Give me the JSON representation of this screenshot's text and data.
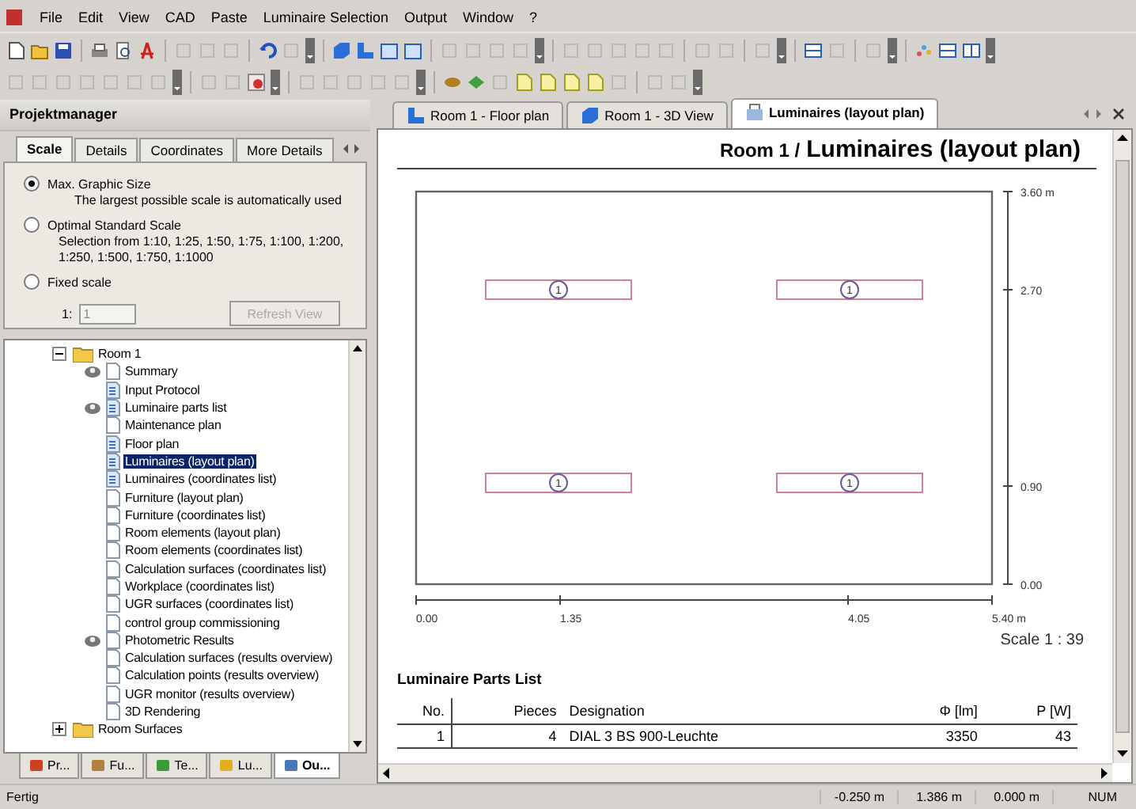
{
  "menu": [
    "File",
    "Edit",
    "View",
    "CAD",
    "Paste",
    "Luminaire Selection",
    "Output",
    "Window",
    "?"
  ],
  "project_manager": {
    "title": "Projektmanager",
    "tabs": [
      {
        "label": "Scale",
        "selected": true
      },
      {
        "label": "Details",
        "selected": false
      },
      {
        "label": "Coordinates",
        "selected": false
      },
      {
        "label": "More Details",
        "selected": false
      }
    ],
    "scale_options": [
      {
        "label": "Max. Graphic Size",
        "description": "The largest possible scale is automatically used",
        "selected": true
      },
      {
        "label": "Optimal Standard Scale",
        "description": "Selection from 1:10, 1:25, 1:50, 1:75, 1:100, 1:200, 1:250, 1:500, 1:750, 1:1000",
        "selected": false
      },
      {
        "label": "Fixed scale",
        "selected": false
      }
    ],
    "fixed_scale": {
      "prefix": "1:",
      "value": "1",
      "disabled": true
    },
    "refresh_button": {
      "label": "Refresh View",
      "disabled": true
    },
    "tree": [
      {
        "label": "Room 1",
        "kind": "folder",
        "expanded": true,
        "children": [
          {
            "label": "Summary",
            "kind": "page",
            "settings": true,
            "selected": false
          },
          {
            "label": "Input Protocol",
            "kind": "report",
            "settings": false,
            "selected": false
          },
          {
            "label": "Luminaire parts list",
            "kind": "report",
            "settings": true,
            "selected": false
          },
          {
            "label": "Maintenance plan",
            "kind": "page",
            "settings": false,
            "selected": false
          },
          {
            "label": "Floor plan",
            "kind": "report",
            "settings": false,
            "selected": false
          },
          {
            "label": "Luminaires (layout plan)",
            "kind": "report",
            "settings": false,
            "selected": true
          },
          {
            "label": "Luminaires (coordinates list)",
            "kind": "report",
            "settings": false,
            "selected": false
          },
          {
            "label": "Furniture (layout plan)",
            "kind": "page",
            "settings": false,
            "selected": false
          },
          {
            "label": "Furniture (coordinates list)",
            "kind": "page",
            "settings": false,
            "selected": false
          },
          {
            "label": "Room elements (layout plan)",
            "kind": "page",
            "settings": false,
            "selected": false
          },
          {
            "label": "Room elements (coordinates list)",
            "kind": "page",
            "settings": false,
            "selected": false
          },
          {
            "label": "Calculation surfaces (coordinates list)",
            "kind": "page",
            "settings": false,
            "selected": false
          },
          {
            "label": "Workplace (coordinates list)",
            "kind": "page",
            "settings": false,
            "selected": false
          },
          {
            "label": "UGR surfaces (coordinates list)",
            "kind": "page",
            "settings": false,
            "selected": false
          },
          {
            "label": "control group commissioning",
            "kind": "page",
            "settings": false,
            "selected": false
          },
          {
            "label": "Photometric Results",
            "kind": "page",
            "settings": true,
            "selected": false
          },
          {
            "label": "Calculation surfaces (results overview)",
            "kind": "page",
            "settings": false,
            "selected": false
          },
          {
            "label": "Calculation points (results overview)",
            "kind": "page",
            "settings": false,
            "selected": false
          },
          {
            "label": "UGR monitor (results overview)",
            "kind": "page",
            "settings": false,
            "selected": false
          },
          {
            "label": "3D Rendering",
            "kind": "page",
            "settings": false,
            "selected": false
          }
        ]
      },
      {
        "label": "Room Surfaces",
        "kind": "folder",
        "expanded": false
      }
    ],
    "bottom_tabs": [
      {
        "label": "Pr...",
        "kind": "project",
        "selected": false
      },
      {
        "label": "Fu...",
        "kind": "furniture",
        "selected": false
      },
      {
        "label": "Te...",
        "kind": "textures",
        "selected": false
      },
      {
        "label": "Lu...",
        "kind": "luminaires",
        "selected": false
      },
      {
        "label": "Ou...",
        "kind": "output",
        "selected": true
      }
    ]
  },
  "document": {
    "tabs": [
      {
        "label": "Room 1 - Floor plan",
        "kind": "floor-plan",
        "selected": false
      },
      {
        "label": "Room 1 - 3D View",
        "kind": "view",
        "selected": false
      },
      {
        "label": "Luminaires (layout plan)",
        "kind": "output",
        "selected": true
      }
    ],
    "room": "Room 1 /",
    "title": "Luminaires (layout plan)",
    "plan": {
      "y_labels": [
        "3.60 m",
        "2.70",
        "0.90",
        "0.00"
      ],
      "x_labels": [
        "0.00",
        "1.35",
        "4.05",
        "5.40 m"
      ],
      "luminaires": [
        {
          "label": "1"
        },
        {
          "label": "1"
        },
        {
          "label": "1"
        },
        {
          "label": "1"
        }
      ]
    },
    "scale": "Scale 1 : 39",
    "parts_list": {
      "title": "Luminaire Parts List",
      "columns": [
        "No.",
        "Pieces",
        "Designation",
        "Φ [lm]",
        "P [W]"
      ],
      "rows": [
        [
          "1",
          "4",
          "DIAL 3 BS 900-Leuchte",
          "3350",
          "43"
        ]
      ]
    }
  },
  "status_bar": {
    "message": "Fertig",
    "fields": [
      "-0.250 m",
      "1.386 m",
      "0.000 m",
      "NUM"
    ]
  }
}
